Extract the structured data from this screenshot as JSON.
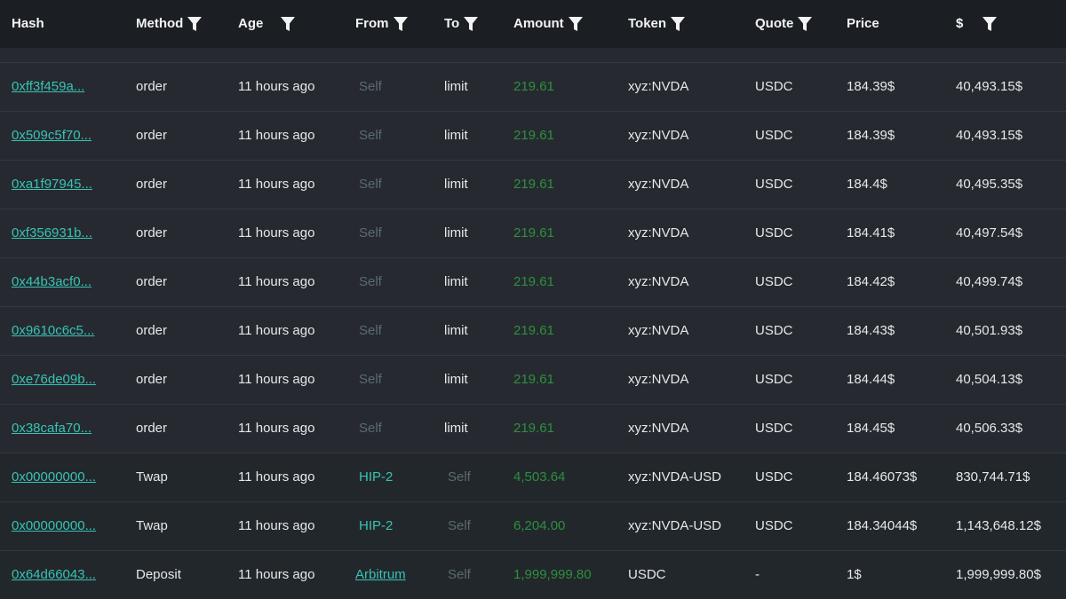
{
  "header": {
    "hash": "Hash",
    "method": "Method",
    "age": "Age",
    "from": "From",
    "to": "To",
    "amount": "Amount",
    "token": "Token",
    "quote": "Quote",
    "price": "Price",
    "usd": "$"
  },
  "colors": {
    "header_bg": "#1b1e22",
    "row_bg": "#262a30",
    "link": "#37c3b4",
    "amount": "#2e8f3e",
    "muted": "#5b6a72",
    "text": "#e6e8ea"
  },
  "rows": [
    {
      "hash": "0xff3f459a...",
      "method": "order",
      "age": "11 hours ago",
      "from": "Self",
      "to": "limit",
      "amount": "219.61",
      "token": "xyz:NVDA",
      "quote": "USDC",
      "price": "184.39$",
      "usd": "40,493.15$"
    },
    {
      "hash": "0x509c5f70...",
      "method": "order",
      "age": "11 hours ago",
      "from": "Self",
      "to": "limit",
      "amount": "219.61",
      "token": "xyz:NVDA",
      "quote": "USDC",
      "price": "184.39$",
      "usd": "40,493.15$"
    },
    {
      "hash": "0xa1f97945...",
      "method": "order",
      "age": "11 hours ago",
      "from": "Self",
      "to": "limit",
      "amount": "219.61",
      "token": "xyz:NVDA",
      "quote": "USDC",
      "price": "184.4$",
      "usd": "40,495.35$"
    },
    {
      "hash": "0xf356931b...",
      "method": "order",
      "age": "11 hours ago",
      "from": "Self",
      "to": "limit",
      "amount": "219.61",
      "token": "xyz:NVDA",
      "quote": "USDC",
      "price": "184.41$",
      "usd": "40,497.54$"
    },
    {
      "hash": "0x44b3acf0...",
      "method": "order",
      "age": "11 hours ago",
      "from": "Self",
      "to": "limit",
      "amount": "219.61",
      "token": "xyz:NVDA",
      "quote": "USDC",
      "price": "184.42$",
      "usd": "40,499.74$"
    },
    {
      "hash": "0x9610c6c5...",
      "method": "order",
      "age": "11 hours ago",
      "from": "Self",
      "to": "limit",
      "amount": "219.61",
      "token": "xyz:NVDA",
      "quote": "USDC",
      "price": "184.43$",
      "usd": "40,501.93$"
    },
    {
      "hash": "0xe76de09b...",
      "method": "order",
      "age": "11 hours ago",
      "from": "Self",
      "to": "limit",
      "amount": "219.61",
      "token": "xyz:NVDA",
      "quote": "USDC",
      "price": "184.44$",
      "usd": "40,504.13$"
    },
    {
      "hash": "0x38cafa70...",
      "method": "order",
      "age": "11 hours ago",
      "from": "Self",
      "to": "limit",
      "amount": "219.61",
      "token": "xyz:NVDA",
      "quote": "USDC",
      "price": "184.45$",
      "usd": "40,506.33$"
    },
    {
      "hash": "0x00000000...",
      "method": "Twap",
      "age": "11 hours ago",
      "from": "HIP-2",
      "to": "Self",
      "amount": "4,503.64",
      "token": "xyz:NVDA-USD",
      "quote": "USDC",
      "price": "184.46073$",
      "usd": "830,744.71$"
    },
    {
      "hash": "0x00000000...",
      "method": "Twap",
      "age": "11 hours ago",
      "from": "HIP-2",
      "to": "Self",
      "amount": "6,204.00",
      "token": "xyz:NVDA-USD",
      "quote": "USDC",
      "price": "184.34044$",
      "usd": "1,143,648.12$"
    },
    {
      "hash": "0x64d66043...",
      "method": "Deposit",
      "age": "11 hours ago",
      "from": "Arbitrum",
      "to": "Self",
      "amount": "1,999,999.80",
      "token": "USDC",
      "quote": "-",
      "price": "1$",
      "usd": "1,999,999.80$"
    }
  ]
}
